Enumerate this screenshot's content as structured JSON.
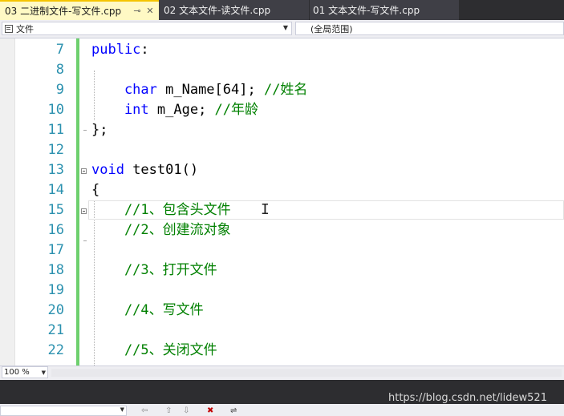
{
  "tabs": [
    {
      "label": "03 二进制文件-写文件.cpp",
      "active": true
    },
    {
      "label": "02 文本文件-读文件.cpp",
      "active": false
    },
    {
      "label": "01 文本文件-写文件.cpp",
      "active": false
    }
  ],
  "tab_icons": {
    "pin": "⊸",
    "close": "✕"
  },
  "navbar": {
    "scope": "文件",
    "members": "(全局范围)"
  },
  "editor": {
    "line_numbers": [
      "7",
      "8",
      "9",
      "10",
      "11",
      "12",
      "13",
      "14",
      "15",
      "16",
      "17",
      "18",
      "19",
      "20",
      "21",
      "22"
    ],
    "lines": [
      [
        {
          "t": "public",
          "c": "kw"
        },
        {
          "t": ":",
          "c": ""
        }
      ],
      [],
      [
        {
          "t": "    char",
          "c": "kw"
        },
        {
          "t": " m_Name[64]; ",
          "c": ""
        },
        {
          "t": "//姓名",
          "c": "cm"
        }
      ],
      [
        {
          "t": "    int",
          "c": "kw"
        },
        {
          "t": " m_Age; ",
          "c": ""
        },
        {
          "t": "//年龄",
          "c": "cm"
        }
      ],
      [
        {
          "t": "};",
          "c": ""
        }
      ],
      [],
      [
        {
          "t": "void",
          "c": "kw"
        },
        {
          "t": " test01()",
          "c": ""
        }
      ],
      [
        {
          "t": "{",
          "c": ""
        }
      ],
      [
        {
          "t": "    //1、包含头文件",
          "c": "cm"
        }
      ],
      [
        {
          "t": "    //2、创建流对象",
          "c": "cm"
        }
      ],
      [],
      [
        {
          "t": "    //3、打开文件",
          "c": "cm"
        }
      ],
      [],
      [
        {
          "t": "    //4、写文件",
          "c": "cm"
        }
      ],
      [],
      [
        {
          "t": "    //5、关闭文件",
          "c": "cm"
        }
      ]
    ]
  },
  "zoom": {
    "label": "100 %"
  },
  "watermark": "https://blog.csdn.net/lidew521",
  "colors": {
    "keyword": "#0000ff",
    "comment": "#008000",
    "line_number": "#2b91af",
    "change_bar": "#6ed06e",
    "active_tab": "#fff9c4"
  }
}
